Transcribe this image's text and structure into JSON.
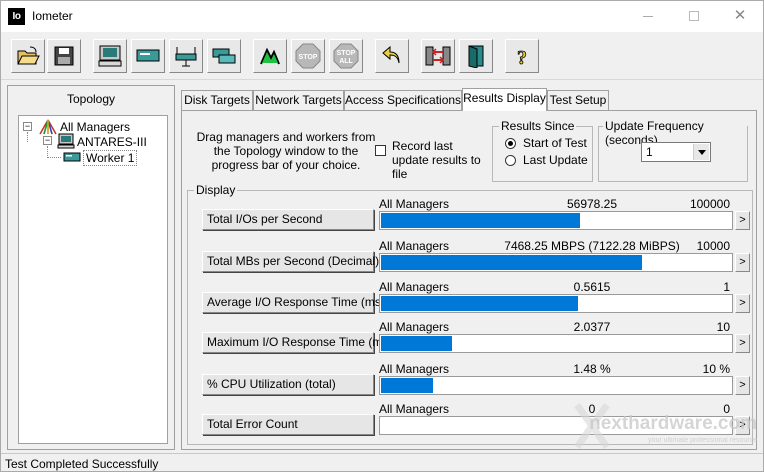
{
  "window": {
    "title": "Iometer",
    "icon_text": "Io"
  },
  "toolbar": {
    "buttons": [
      {
        "name": "open-config-icon"
      },
      {
        "name": "save-config-icon"
      },
      {
        "name": "new-disk-worker-icon"
      },
      {
        "name": "new-network-worker-icon"
      },
      {
        "name": "duplicate-worker-icon"
      },
      {
        "name": "worker-icon"
      },
      {
        "name": "start-tests-icon"
      },
      {
        "name": "stop-icon",
        "label": "STOP"
      },
      {
        "name": "stop-all-icon",
        "label": "STOP ALL"
      },
      {
        "name": "reset-workers-icon"
      },
      {
        "name": "disconnect-icon"
      },
      {
        "name": "exit-icon"
      },
      {
        "name": "help-icon",
        "label": "?"
      }
    ]
  },
  "topology": {
    "title": "Topology",
    "nodes": [
      {
        "label": "All Managers",
        "expander": "−"
      },
      {
        "label": "ANTARES-III",
        "expander": "−"
      },
      {
        "label": "Worker 1"
      }
    ]
  },
  "tabs": [
    {
      "label": "Disk Targets"
    },
    {
      "label": "Network Targets"
    },
    {
      "label": "Access Specifications"
    },
    {
      "label": "Results Display"
    },
    {
      "label": "Test Setup"
    }
  ],
  "results": {
    "hint": "Drag managers and workers from the Topology window to the progress bar of your choice.",
    "record_label": "Record last update results to file",
    "record_checked": false,
    "since": {
      "title": "Results Since",
      "options": [
        "Start of Test",
        "Last Update"
      ],
      "selected": 0
    },
    "update_frequency": {
      "title": "Update Frequency (seconds)",
      "value": "1"
    },
    "display_title": "Display",
    "metrics": [
      {
        "button": "Total I/Os per Second",
        "target": "All Managers",
        "value": "56978.25",
        "max": "100000",
        "fraction": 0.5698
      },
      {
        "button": "Total MBs per Second (Decimal)",
        "target": "All Managers",
        "value": "7468.25 MBPS (7122.28 MiBPS)",
        "max": "10000",
        "fraction": 0.7468
      },
      {
        "button": "Average I/O Response Time (ms)",
        "target": "All Managers",
        "value": "0.5615",
        "max": "1",
        "fraction": 0.5615
      },
      {
        "button": "Maximum I/O Response Time (ms)",
        "target": "All Managers",
        "value": "2.0377",
        "max": "10",
        "fraction": 0.2038
      },
      {
        "button": "% CPU Utilization (total)",
        "target": "All Managers",
        "value": "1.48 %",
        "max": "10 %",
        "fraction": 0.148
      },
      {
        "button": "Total Error Count",
        "target": "All Managers",
        "value": "0",
        "max": "0",
        "fraction": 0
      }
    ],
    "arrow_label": ">"
  },
  "status": {
    "text": "Test Completed Successfully"
  },
  "watermark": {
    "brand": "nexthardware.com",
    "tagline": "your ultimate professional resource"
  },
  "colors": {
    "progress_fill": "#0078d7",
    "window_bg": "#f0f0f0"
  }
}
